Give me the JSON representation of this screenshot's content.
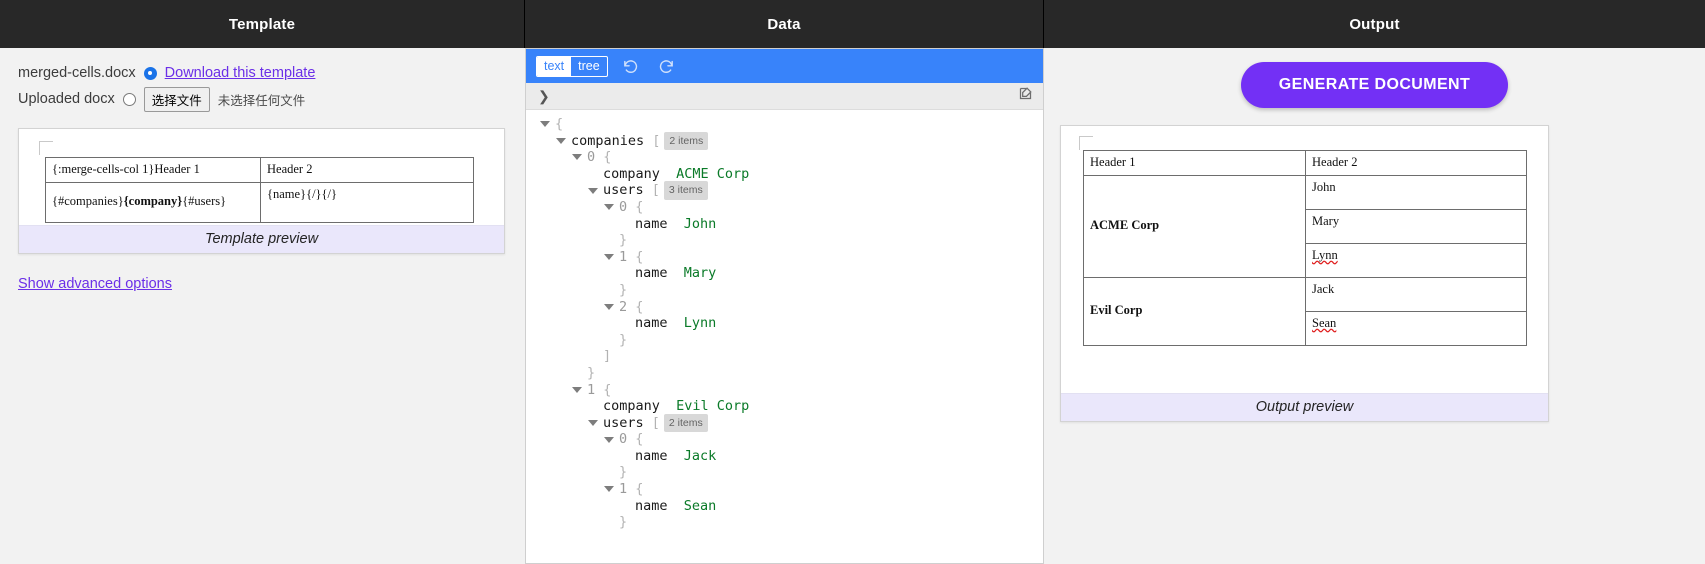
{
  "panels": {
    "template_title": "Template",
    "data_title": "Data",
    "output_title": "Output"
  },
  "template": {
    "file_name": "merged-cells.docx",
    "download_link": "Download this template",
    "uploaded_label": "Uploaded docx",
    "choose_file_button": "选择文件",
    "no_file_text": "未选择任何文件",
    "preview_caption": "Template preview",
    "advanced_link": "Show advanced options",
    "table": {
      "header_cell_1": "{:merge-cells-col 1}Header 1",
      "header_cell_2": "Header 2",
      "body_cell_1_a": "{#companies}",
      "body_cell_1_b": "{company}",
      "body_cell_1_c": "{#users}",
      "body_cell_2": "{name}{/}{/}"
    }
  },
  "data_editor": {
    "mode_text": "text",
    "mode_tree": "tree",
    "mode_selected": "text",
    "undo_icon": "undo-icon",
    "redo_icon": "redo-icon",
    "search_chevron": "chevron-right-icon",
    "edit_icon": "edit-pencil-icon",
    "tree": [
      {
        "indent": 0,
        "toggle": true,
        "key": "",
        "open": "{",
        "value": "",
        "count": ""
      },
      {
        "indent": 1,
        "toggle": true,
        "key": "companies",
        "open": "[",
        "value": "",
        "count": "2 items"
      },
      {
        "indent": 2,
        "toggle": true,
        "key": "0",
        "open": "{",
        "value": "",
        "count": "",
        "index": true
      },
      {
        "indent": 3,
        "toggle": false,
        "key": "company",
        "open": "",
        "value": "ACME Corp",
        "count": ""
      },
      {
        "indent": 3,
        "toggle": true,
        "key": "users",
        "open": "[",
        "value": "",
        "count": "3 items"
      },
      {
        "indent": 4,
        "toggle": true,
        "key": "0",
        "open": "{",
        "value": "",
        "count": "",
        "index": true
      },
      {
        "indent": 5,
        "toggle": false,
        "key": "name",
        "open": "",
        "value": "John",
        "count": ""
      },
      {
        "indent": 4,
        "toggle": false,
        "key": "",
        "open": "}",
        "value": "",
        "count": ""
      },
      {
        "indent": 4,
        "toggle": true,
        "key": "1",
        "open": "{",
        "value": "",
        "count": "",
        "index": true
      },
      {
        "indent": 5,
        "toggle": false,
        "key": "name",
        "open": "",
        "value": "Mary",
        "count": ""
      },
      {
        "indent": 4,
        "toggle": false,
        "key": "",
        "open": "}",
        "value": "",
        "count": ""
      },
      {
        "indent": 4,
        "toggle": true,
        "key": "2",
        "open": "{",
        "value": "",
        "count": "",
        "index": true
      },
      {
        "indent": 5,
        "toggle": false,
        "key": "name",
        "open": "",
        "value": "Lynn",
        "count": ""
      },
      {
        "indent": 4,
        "toggle": false,
        "key": "",
        "open": "}",
        "value": "",
        "count": ""
      },
      {
        "indent": 3,
        "toggle": false,
        "key": "",
        "open": "]",
        "value": "",
        "count": ""
      },
      {
        "indent": 2,
        "toggle": false,
        "key": "",
        "open": "}",
        "value": "",
        "count": ""
      },
      {
        "indent": 2,
        "toggle": true,
        "key": "1",
        "open": "{",
        "value": "",
        "count": "",
        "index": true
      },
      {
        "indent": 3,
        "toggle": false,
        "key": "company",
        "open": "",
        "value": "Evil Corp",
        "count": ""
      },
      {
        "indent": 3,
        "toggle": true,
        "key": "users",
        "open": "[",
        "value": "",
        "count": "2 items"
      },
      {
        "indent": 4,
        "toggle": true,
        "key": "0",
        "open": "{",
        "value": "",
        "count": "",
        "index": true
      },
      {
        "indent": 5,
        "toggle": false,
        "key": "name",
        "open": "",
        "value": "Jack",
        "count": ""
      },
      {
        "indent": 4,
        "toggle": false,
        "key": "",
        "open": "}",
        "value": "",
        "count": ""
      },
      {
        "indent": 4,
        "toggle": true,
        "key": "1",
        "open": "{",
        "value": "",
        "count": "",
        "index": true
      },
      {
        "indent": 5,
        "toggle": false,
        "key": "name",
        "open": "",
        "value": "Sean",
        "count": ""
      },
      {
        "indent": 4,
        "toggle": false,
        "key": "",
        "open": "}",
        "value": "",
        "count": ""
      }
    ]
  },
  "output": {
    "generate_button": "GENERATE DOCUMENT",
    "preview_caption": "Output preview",
    "table": {
      "header_1": "Header 1",
      "header_2": "Header 2",
      "rows": [
        {
          "company": "ACME Corp",
          "users": [
            {
              "name": "John",
              "misspelled": false
            },
            {
              "name": "Mary",
              "misspelled": false
            },
            {
              "name": "Lynn",
              "misspelled": true
            }
          ]
        },
        {
          "company": "Evil Corp",
          "users": [
            {
              "name": "Jack",
              "misspelled": false
            },
            {
              "name": "Sean",
              "misspelled": true
            }
          ]
        }
      ]
    }
  },
  "colors": {
    "header_bar": "#282828",
    "accent_purple": "#7330f5",
    "link_purple": "#6b2fe8",
    "editor_blue": "#3883fa",
    "caption_bg": "#eae7fb",
    "spellcheck_red": "#e02020"
  }
}
